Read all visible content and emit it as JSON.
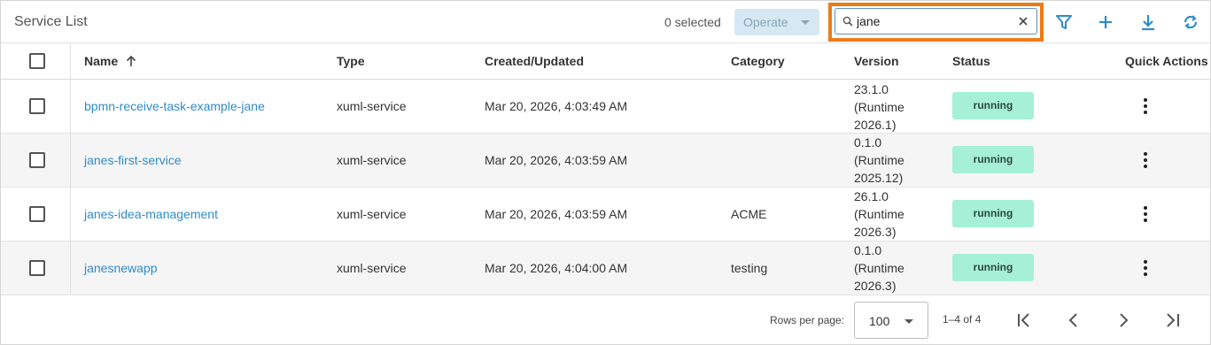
{
  "header": {
    "title": "Service List",
    "selected_count": "0 selected",
    "operate_label": "Operate",
    "search_value": "jane"
  },
  "columns": {
    "name": "Name",
    "type": "Type",
    "created": "Created/Updated",
    "category": "Category",
    "version": "Version",
    "status": "Status",
    "quick_actions": "Quick Actions"
  },
  "rows": [
    {
      "name": "bpmn-receive-task-example-jane",
      "type": "xuml-service",
      "created": "Mar 20, 2026, 4:03:49 AM",
      "category": "",
      "version_line1": "23.1.0",
      "version_line2": "(Runtime",
      "version_line3": "2026.1)",
      "status": "running"
    },
    {
      "name": "janes-first-service",
      "type": "xuml-service",
      "created": "Mar 20, 2026, 4:03:59 AM",
      "category": "",
      "version_line1": "0.1.0",
      "version_line2": "(Runtime",
      "version_line3": "2025.12)",
      "status": "running"
    },
    {
      "name": "janes-idea-management",
      "type": "xuml-service",
      "created": "Mar 20, 2026, 4:03:59 AM",
      "category": "ACME",
      "version_line1": "26.1.0",
      "version_line2": "(Runtime",
      "version_line3": "2026.3)",
      "status": "running"
    },
    {
      "name": "janesnewapp",
      "type": "xuml-service",
      "created": "Mar 20, 2026, 4:04:00 AM",
      "category": "testing",
      "version_line1": "0.1.0",
      "version_line2": "(Runtime",
      "version_line3": "2026.3)",
      "status": "running"
    }
  ],
  "footer": {
    "rows_per_page_label": "Rows per page:",
    "rows_per_page_value": "100",
    "range": "1–4 of 4"
  },
  "colors": {
    "accent": "#2f8bc9",
    "highlight": "#ee7b15",
    "status_running": "#a6f0d8"
  },
  "icons": [
    "search-icon",
    "clear-icon",
    "filter-icon",
    "plus-icon",
    "download-icon",
    "refresh-icon",
    "sort-arrow-up-icon",
    "more-vertical-icon",
    "first-page-icon",
    "previous-page-icon",
    "next-page-icon",
    "last-page-icon"
  ]
}
